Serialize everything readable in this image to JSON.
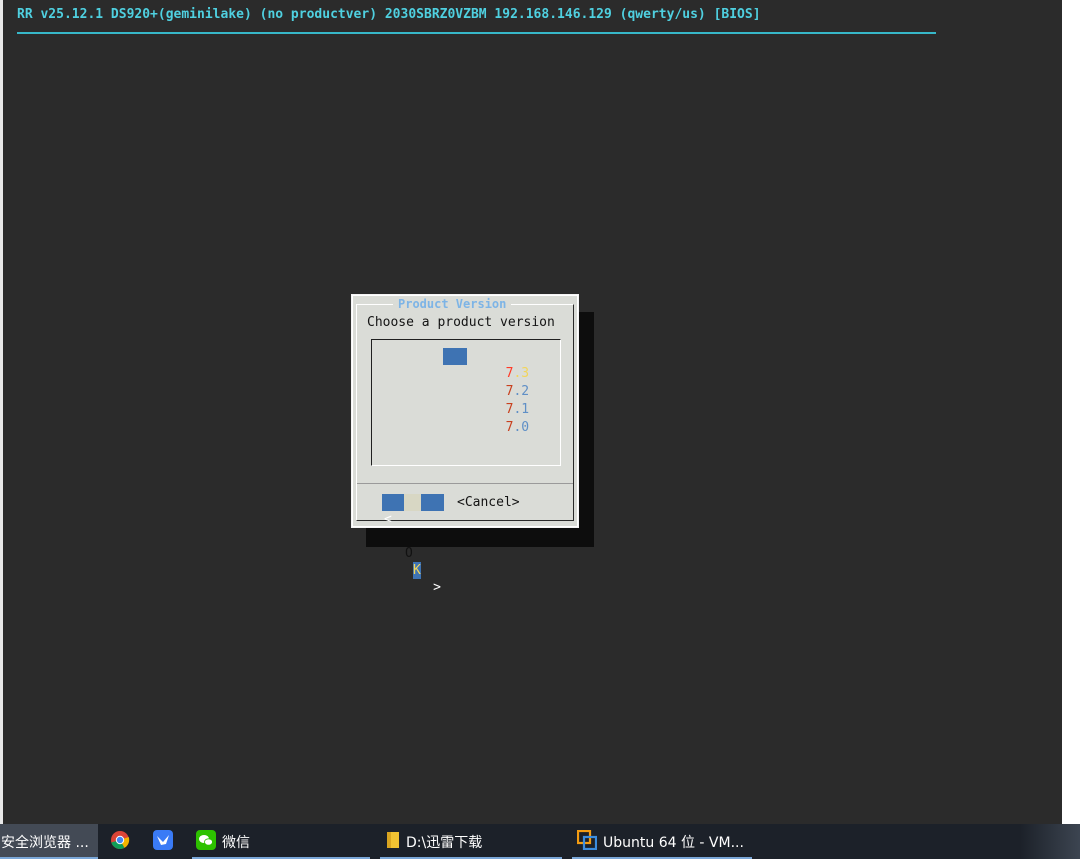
{
  "terminal": {
    "header": "RR v25.12.1 DS920+(geminilake) (no productver) 2030SBRZ0VZBM 192.168.146.129 (qwerty/us) [BIOS]"
  },
  "dialog": {
    "title": "Product Version",
    "prompt": "Choose a product version",
    "items": [
      {
        "first": "7",
        "rest": ".3",
        "selected": true
      },
      {
        "first": "7",
        "rest": ".2",
        "selected": false
      },
      {
        "first": "7",
        "rest": ".1",
        "selected": false
      },
      {
        "first": "7",
        "rest": ".0",
        "selected": false
      }
    ],
    "ok": {
      "left": "<",
      "o": "O",
      "k": "K",
      "right": ">"
    },
    "cancel_label": "<Cancel>"
  },
  "taskbar": {
    "browser_label": "安全浏览器 ...",
    "chrome_icon": "chrome-icon",
    "feishu_icon": "feishu-icon",
    "wechat_label": "微信",
    "explorer_label": "D:\\迅雷下载",
    "vm_label": "Ubuntu 64 位 - VM..."
  },
  "colors": {
    "terminal_bg": "#2b2b2b",
    "header_text": "#4fd0e0",
    "dialog_bg": "#dadcd7",
    "dialog_title": "#7db4e6",
    "selection": "#3e73b3",
    "taskbar_bg": "#1c2129"
  }
}
